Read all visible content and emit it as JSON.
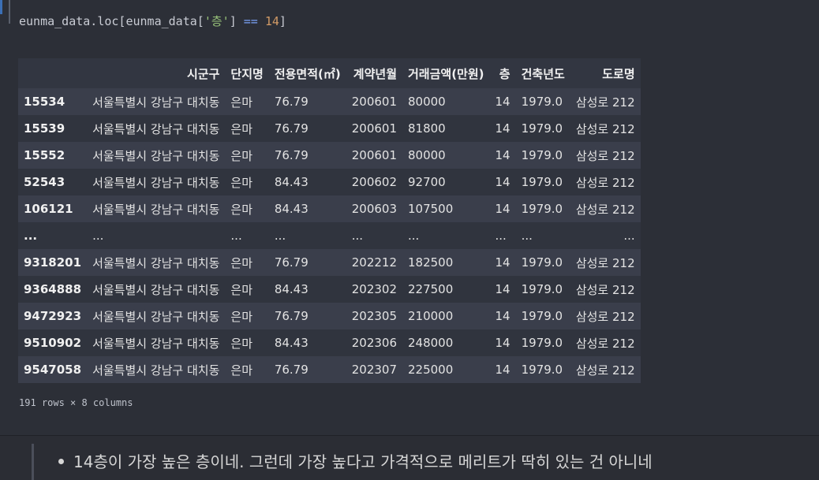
{
  "code_cell": {
    "code_prefix": "eunma_data.loc[eunma_data[",
    "code_string": "'층'",
    "code_mid": "] ",
    "code_op": "==",
    "code_space": " ",
    "code_number": "14",
    "code_suffix": "]"
  },
  "table": {
    "columns": [
      "시군구",
      "단지명",
      "전용면적(㎡)",
      "계약년월",
      "거래금액(만원)",
      "층",
      "건축년도",
      "도로명"
    ],
    "rows": [
      {
        "index": "15534",
        "cells": [
          "서울특별시 강남구 대치동",
          "은마",
          "76.79",
          "200601",
          "80000",
          "14",
          "1979.0",
          "삼성로 212"
        ]
      },
      {
        "index": "15539",
        "cells": [
          "서울특별시 강남구 대치동",
          "은마",
          "76.79",
          "200601",
          "81800",
          "14",
          "1979.0",
          "삼성로 212"
        ]
      },
      {
        "index": "15552",
        "cells": [
          "서울특별시 강남구 대치동",
          "은마",
          "76.79",
          "200601",
          "80000",
          "14",
          "1979.0",
          "삼성로 212"
        ]
      },
      {
        "index": "52543",
        "cells": [
          "서울특별시 강남구 대치동",
          "은마",
          "84.43",
          "200602",
          "92700",
          "14",
          "1979.0",
          "삼성로 212"
        ]
      },
      {
        "index": "106121",
        "cells": [
          "서울특별시 강남구 대치동",
          "은마",
          "84.43",
          "200603",
          "107500",
          "14",
          "1979.0",
          "삼성로 212"
        ]
      },
      {
        "index": "...",
        "cells": [
          "...",
          "...",
          "...",
          "...",
          "...",
          "...",
          "...",
          "..."
        ]
      },
      {
        "index": "9318201",
        "cells": [
          "서울특별시 강남구 대치동",
          "은마",
          "76.79",
          "202212",
          "182500",
          "14",
          "1979.0",
          "삼성로 212"
        ]
      },
      {
        "index": "9364888",
        "cells": [
          "서울특별시 강남구 대치동",
          "은마",
          "84.43",
          "202302",
          "227500",
          "14",
          "1979.0",
          "삼성로 212"
        ]
      },
      {
        "index": "9472923",
        "cells": [
          "서울특별시 강남구 대치동",
          "은마",
          "76.79",
          "202305",
          "210000",
          "14",
          "1979.0",
          "삼성로 212"
        ]
      },
      {
        "index": "9510902",
        "cells": [
          "서울특별시 강남구 대치동",
          "은마",
          "84.43",
          "202306",
          "248000",
          "14",
          "1979.0",
          "삼성로 212"
        ]
      },
      {
        "index": "9547058",
        "cells": [
          "서울특별시 강남구 대치동",
          "은마",
          "76.79",
          "202307",
          "225000",
          "14",
          "1979.0",
          "삼성로 212"
        ]
      }
    ]
  },
  "shape_text": "191 rows × 8 columns",
  "markdown": {
    "bullet_text": "14층이 가장 높은 층이네. 그런데 가장 높다고 가격적으로 메리트가 딱히 있는 건 아니네"
  }
}
